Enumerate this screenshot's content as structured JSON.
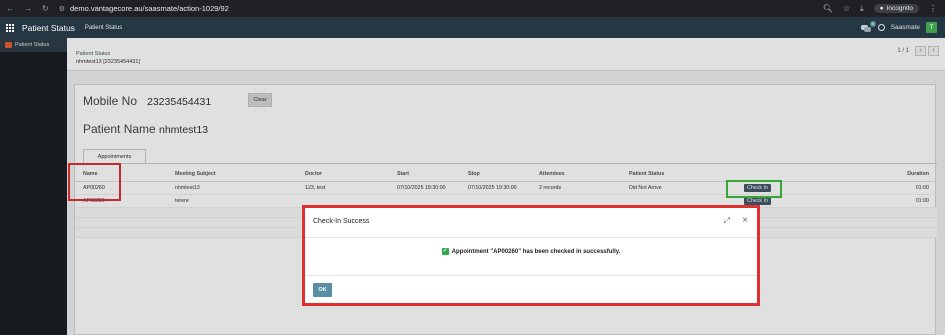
{
  "browser": {
    "url": "demo.vantagecore.au/saasmate/action-1029/92",
    "incognito_label": "Incognito"
  },
  "navbar": {
    "app_title": "Patient Status",
    "menu_item": "Patient Status",
    "message_count": "5",
    "user_name": "Saasmate",
    "user_initial": "T"
  },
  "sidebar": {
    "items": [
      {
        "label": "Patient Status"
      }
    ]
  },
  "breadcrumb": {
    "parent": "Patient Status",
    "current": "nhmtest13 [23235454431]"
  },
  "pager": {
    "value": "1 / 1"
  },
  "form": {
    "mobile_label": "Mobile No",
    "mobile_value": "23235454431",
    "clear_label": "Clear",
    "name_label": "Patient Name",
    "name_value": "nhmtest13",
    "tab_label": "Appointments"
  },
  "table": {
    "columns": [
      "Name",
      "Meeting Subject",
      "Doctor",
      "Start",
      "Stop",
      "Attendees",
      "Patient Status",
      "",
      "Duration"
    ],
    "rows": [
      {
        "name": "AP00260",
        "subject": "nhmtest13",
        "doctor": "123, test",
        "start": "07/10/2025 18:30:00",
        "stop": "07/10/2025 19:30:00",
        "attendees": "2 records",
        "status": "Did Not Arrive",
        "action": "Check In",
        "duration": "01:00"
      },
      {
        "name": "AP00250",
        "subject": "terere",
        "doctor": "",
        "start": "",
        "stop": "",
        "attendees": "",
        "status": "",
        "action": "Check In",
        "duration": "01:00"
      }
    ]
  },
  "dialog": {
    "title": "Check-In Success",
    "message": "Appointment \"AP00260\" has been checked in successfully.",
    "ok_label": "OK"
  },
  "colors": {
    "navbar": "#243742",
    "annotation_red": "#e0302f",
    "annotation_green": "#3cbd3a",
    "primary_button": "#5a8fa3"
  }
}
